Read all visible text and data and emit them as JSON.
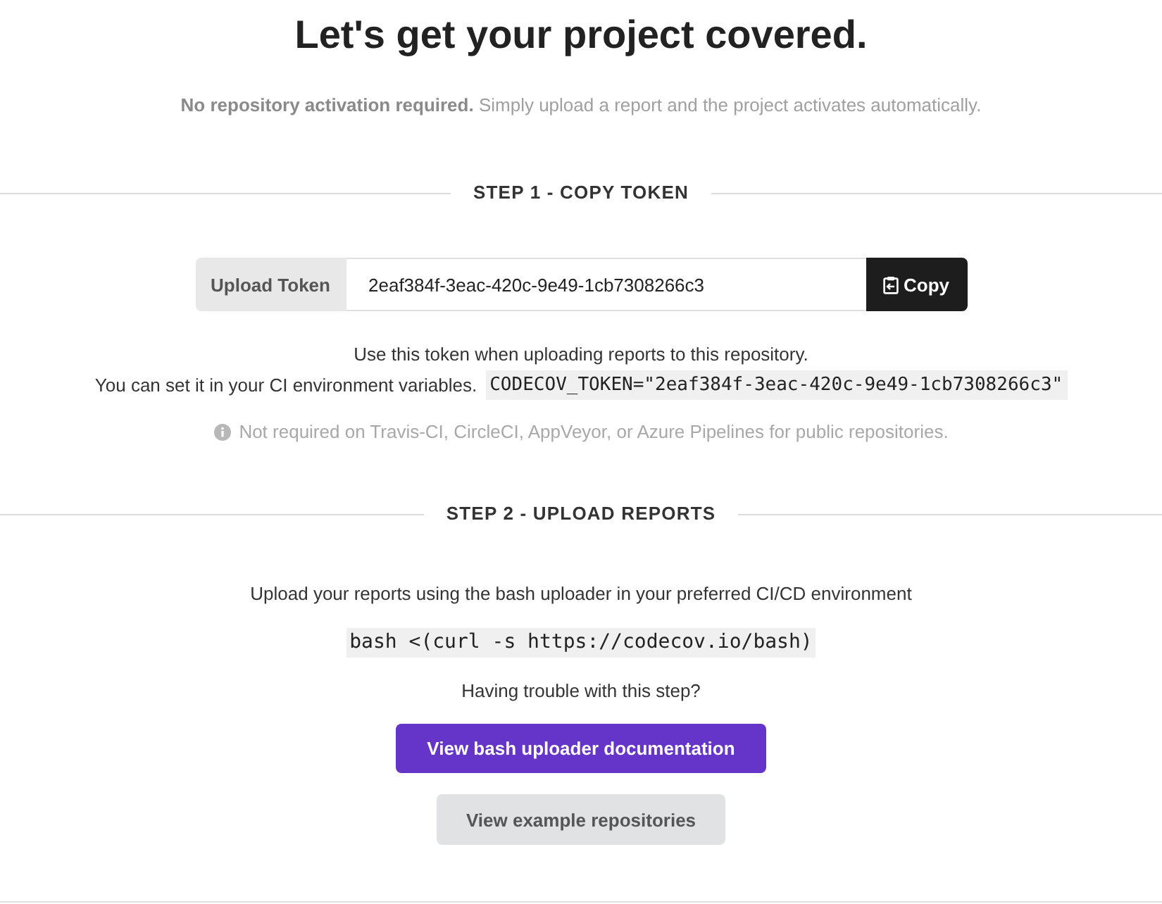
{
  "header": {
    "title": "Let's get your project covered.",
    "subtitle": "**No repository activation required.** Simply upload a report and the project activates automatically."
  },
  "step_1": {
    "heading": "STEP 1 - COPY TOKEN",
    "token_label": "Upload Token",
    "token_value": "2eaf384f-3eac-420c-9e49-1cb7308266c3",
    "copy_button": "Copy",
    "usage_text": "Use this token when uploading reports to this repository.",
    "env_text": "You can set it in your CI environment variables.",
    "env_code": "CODECOV_TOKEN=\"2eaf384f-3eac-420c-9e49-1cb7308266c3\"",
    "note": "Not required on Travis-CI, CircleCI, AppVeyor, or Azure Pipelines for public repositories."
  },
  "step_2": {
    "heading": "STEP 2 - UPLOAD REPORTS",
    "instruction": "Upload your reports using the bash uploader in your preferred CI/CD environment",
    "command": "bash <(curl -s https://codecov.io/bash)",
    "help_text": "Having trouble with this step?",
    "buttons": [
      {
        "label": "View bash uploader documentation",
        "kind": "primary"
      },
      {
        "label": "View example repositories",
        "kind": "secondary"
      }
    ]
  }
}
